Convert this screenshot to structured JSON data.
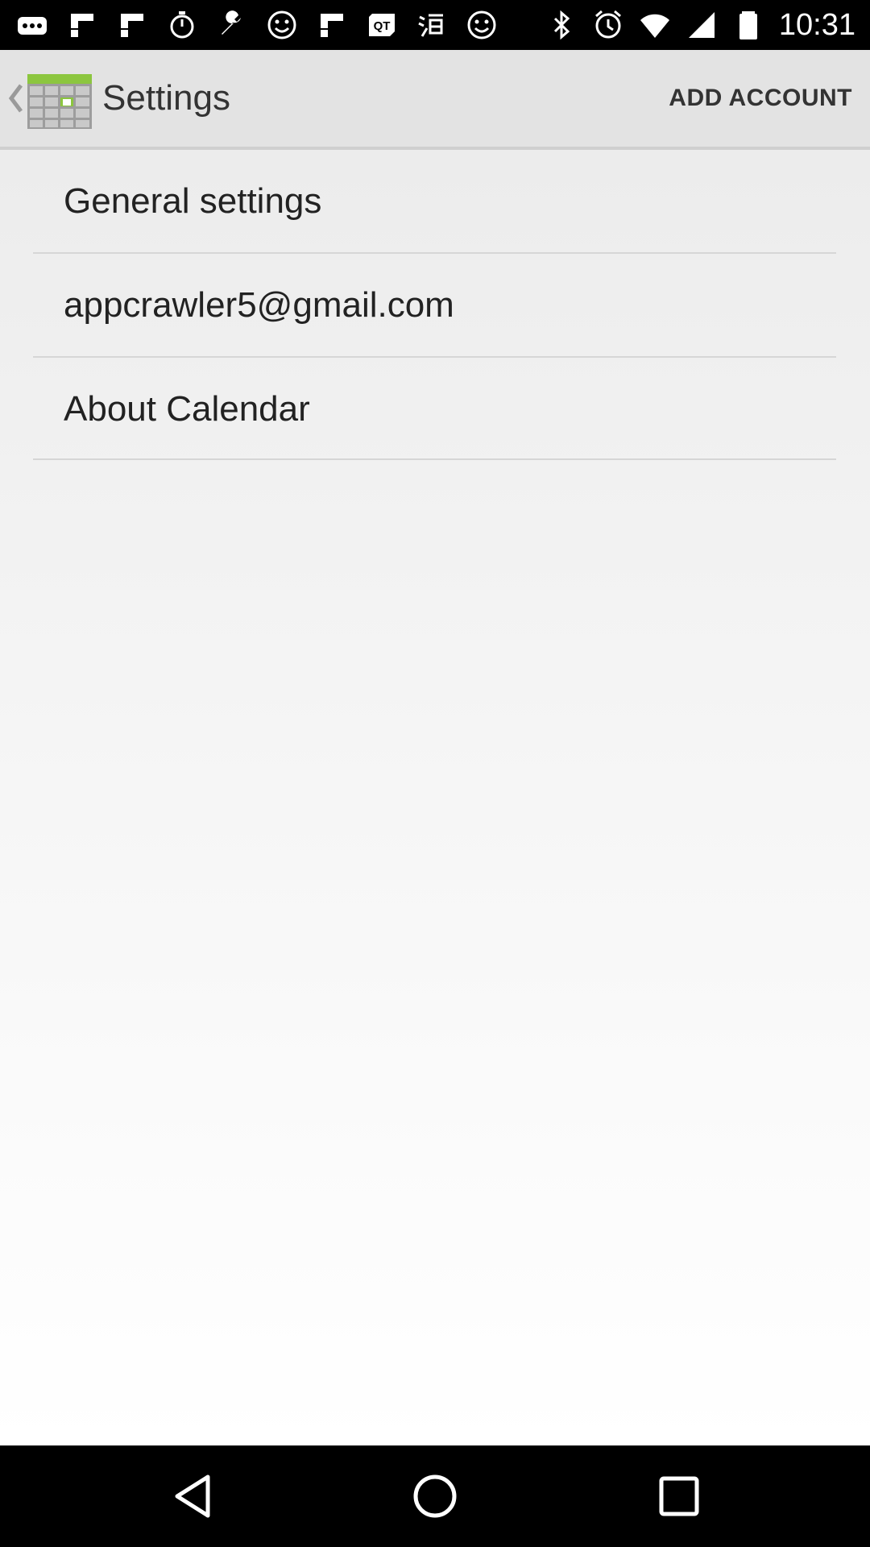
{
  "status_bar": {
    "time": "10:31",
    "left_icons": [
      "more-icon",
      "flipboard-icon",
      "flipboard-icon",
      "stopwatch-icon",
      "wrench-icon",
      "smiley-icon",
      "flipboard-icon",
      "qt-icon",
      "taobao-icon",
      "smiley-icon"
    ],
    "right_icons": [
      "bluetooth-icon",
      "alarm-icon",
      "wifi-icon",
      "signal-icon",
      "battery-icon"
    ]
  },
  "app_bar": {
    "title": "Settings",
    "action_label": "ADD ACCOUNT",
    "accent_color": "#8cc63f"
  },
  "list": {
    "items": [
      {
        "label": "General settings"
      },
      {
        "label": "appcrawler5@gmail.com"
      },
      {
        "label": "About Calendar"
      }
    ]
  },
  "nav_bar": {
    "buttons": [
      "back-icon",
      "home-icon",
      "recents-icon"
    ]
  }
}
